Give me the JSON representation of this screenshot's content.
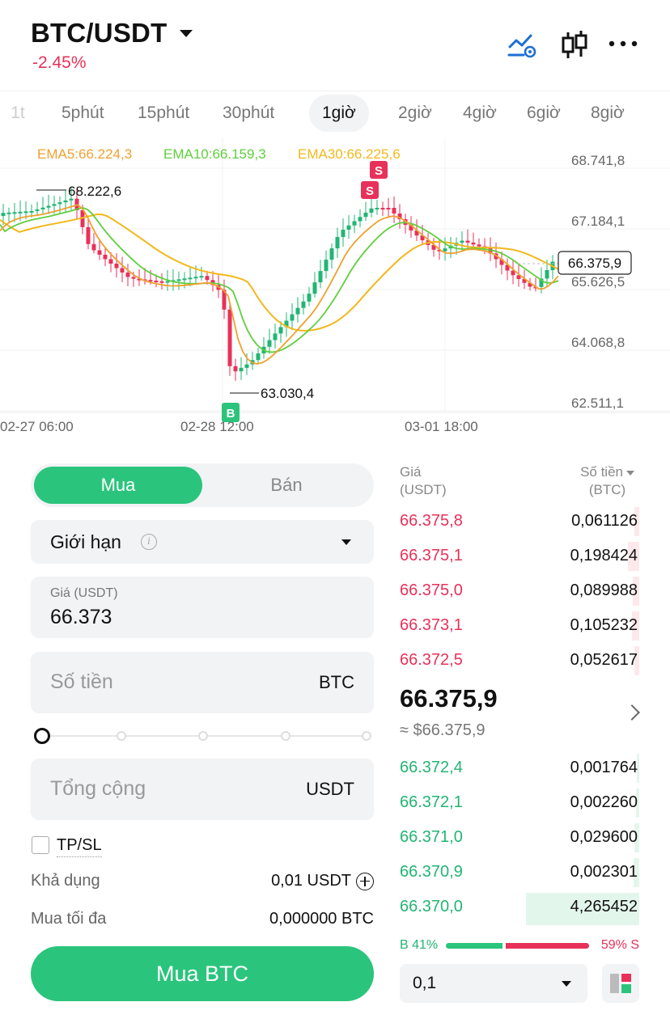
{
  "header": {
    "pair": "BTC/USDT",
    "change": "-2.45%",
    "icons": [
      "chart-signal-icon",
      "candlestick-icon",
      "more-icon"
    ]
  },
  "timeframes": {
    "items": [
      "1t",
      "5phút",
      "15phút",
      "30phút",
      "1giờ",
      "2giờ",
      "4giờ",
      "6giờ",
      "8giờ"
    ],
    "active": "1giờ"
  },
  "chart": {
    "ema5": "EMA5:66.224,3",
    "ema10": "EMA10:66.159,3",
    "ema30": "EMA30:66.225,6",
    "price_ticks": [
      "68.741,8",
      "67.184,1",
      "65.626,5",
      "64.068,8",
      "62.511,1"
    ],
    "date_ticks": [
      "02-27 06:00",
      "02-28 12:00",
      "03-01 18:00"
    ],
    "high_marker": "68.222,6",
    "low_marker": "63.030,4",
    "last_price_tag": "66.375,9",
    "signal_sell": "S",
    "signal_buy": "B",
    "colors": {
      "up": "#22b573",
      "down": "#e8315a",
      "ema5": "#f0a030",
      "ema10": "#5fcf3c",
      "ema30": "#f2b81c"
    }
  },
  "form": {
    "tab_buy": "Mua",
    "tab_sell": "Bán",
    "order_type": "Giới hạn",
    "price_label": "Giá (USDT)",
    "price_value": "66.373",
    "amount_placeholder": "Số tiền",
    "amount_unit": "BTC",
    "total_placeholder": "Tổng cộng",
    "total_unit": "USDT",
    "tpsl": "TP/SL",
    "available_label": "Khả dụng",
    "available_value": "0,01 USDT",
    "max_buy_label": "Mua tối đa",
    "max_buy_value": "0,000000 BTC",
    "submit": "Mua BTC",
    "accent": "#2bc47c"
  },
  "orderbook": {
    "price_header_1": "Giá",
    "price_header_2": "(USDT)",
    "amount_header_1": "Số tiền",
    "amount_header_2": "(BTC)",
    "asks": [
      {
        "price": "66.375,8",
        "qty": "0,061126"
      },
      {
        "price": "66.375,1",
        "qty": "0,198424"
      },
      {
        "price": "66.375,0",
        "qty": "0,089988"
      },
      {
        "price": "66.373,1",
        "qty": "0,105232"
      },
      {
        "price": "66.372,5",
        "qty": "0,052617"
      }
    ],
    "mid_price": "66.375,9",
    "mid_usd": "≈ $66.375,9",
    "bids": [
      {
        "price": "66.372,4",
        "qty": "0,001764"
      },
      {
        "price": "66.372,1",
        "qty": "0,002260"
      },
      {
        "price": "66.371,0",
        "qty": "0,029600"
      },
      {
        "price": "66.370,9",
        "qty": "0,002301"
      },
      {
        "price": "66.370,0",
        "qty": "4,265452"
      }
    ],
    "buy_ratio": "B 41%",
    "sell_ratio": "59% S",
    "step": "0,1"
  }
}
